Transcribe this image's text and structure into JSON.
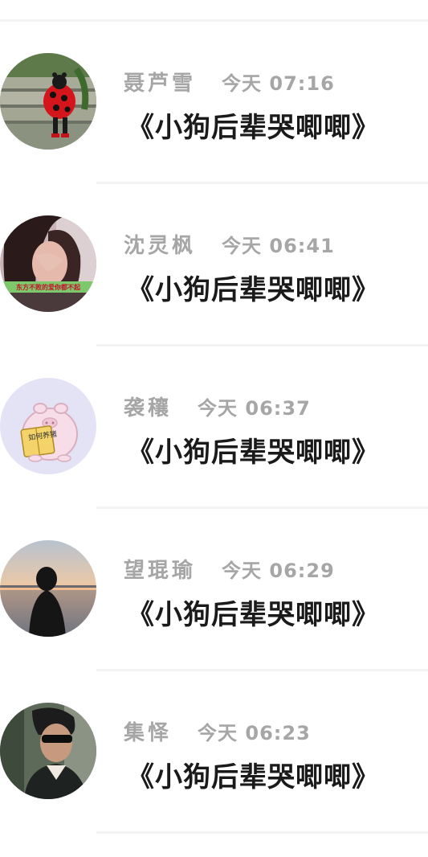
{
  "comments": [
    {
      "name": "聂芦雪",
      "time": "今天 07:16",
      "message": "《小狗后辈哭唧唧》",
      "avatar_icon": "ladybug-costume-avatar"
    },
    {
      "name": "沈灵枫",
      "time": "今天 06:41",
      "message": "《小狗后辈哭唧唧》",
      "avatar_icon": "girl-covering-face-avatar",
      "avatar_caption": "东方不败的爱你都不起"
    },
    {
      "name": "袭穰",
      "time": "今天 06:37",
      "message": "《小狗后辈哭唧唧》",
      "avatar_icon": "cartoon-pig-reading-avatar",
      "avatar_caption": "如何养猪"
    },
    {
      "name": "望琨瑜",
      "time": "今天 06:29",
      "message": "《小狗后辈哭唧唧》",
      "avatar_icon": "sunset-silhouette-avatar"
    },
    {
      "name": "集怿",
      "time": "今天 06:23",
      "message": "《小狗后辈哭唧唧》",
      "avatar_icon": "man-sunglasses-avatar"
    }
  ]
}
